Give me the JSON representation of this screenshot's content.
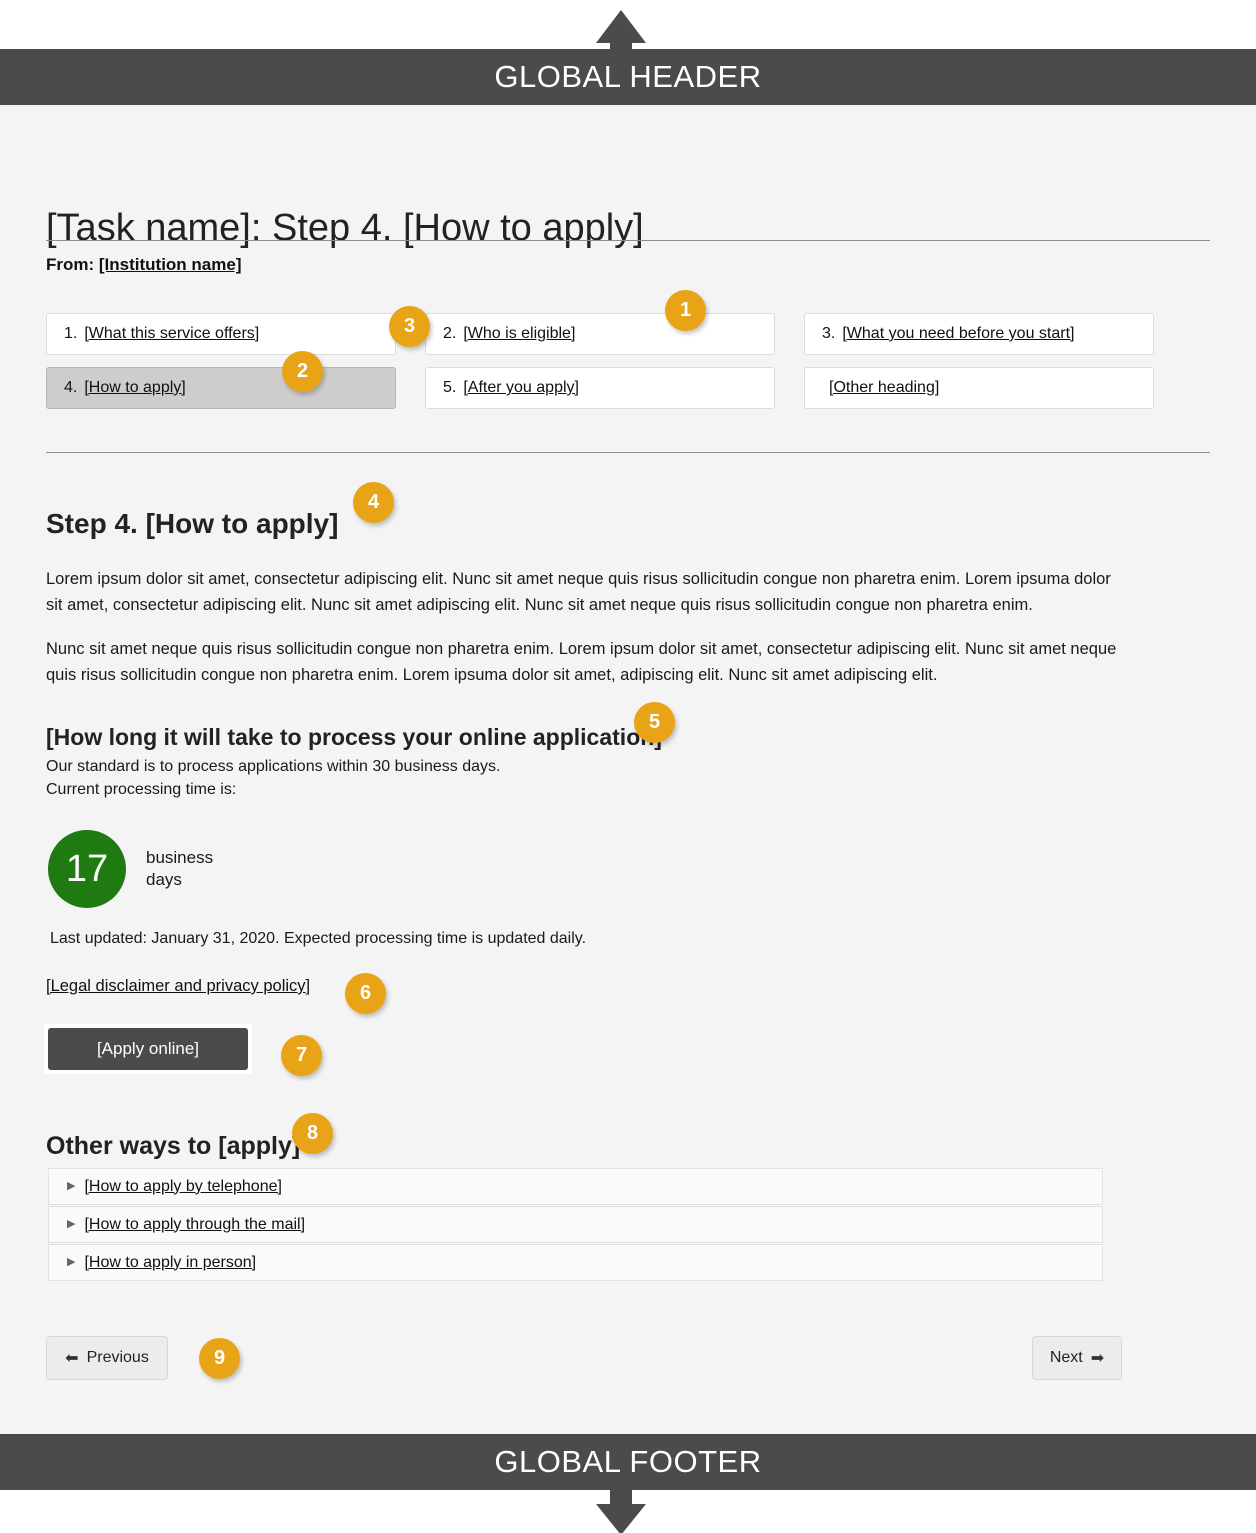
{
  "global": {
    "header_label": "GLOBAL HEADER",
    "footer_label": "GLOBAL FOOTER",
    "bar_color": "#4b4b4b",
    "canvas_color": "#f4f4f4"
  },
  "callouts": {
    "color": "#e8a317",
    "items": [
      "1",
      "2",
      "3",
      "4",
      "5",
      "6",
      "7",
      "8",
      "9"
    ]
  },
  "page": {
    "title": "[Task name]: Step 4. [How to apply]",
    "from_prefix": "From: ",
    "from_institution": "[Institution name]"
  },
  "nav_tiles": [
    {
      "num": "1.",
      "label": "[What this service offers]",
      "active": false
    },
    {
      "num": "2.",
      "label": "[Who is eligible]",
      "active": false
    },
    {
      "num": "3.",
      "label": "[What you need before you start]",
      "active": false
    },
    {
      "num": "4.",
      "label": "[How to apply]",
      "active": true
    },
    {
      "num": "5.",
      "label": "[After you apply]",
      "active": false
    },
    {
      "num": "",
      "label": "[Other heading]",
      "active": false
    }
  ],
  "step": {
    "heading": "Step 4.  [How to apply]",
    "paragraph_1": "Lorem ipsum dolor sit amet, consectetur adipiscing elit. Nunc sit amet neque quis  risus sollicitudin congue non pharetra enim. Lorem ipsuma dolor sit amet, consectetur adipiscing elit. Nunc sit amet adipiscing elit. Nunc sit amet neque quis risus sollicitudin congue non pharetra enim.",
    "paragraph_2": "Nunc sit amet neque quis risus sollicitudin congue non pharetra enim.  Lorem ipsum dolor sit amet, consectetur adipiscing elit. Nunc sit amet neque quis  risus sollicitudin congue non pharetra enim. Lorem ipsuma dolor sit amet, adipiscing elit. Nunc sit amet adipiscing elit."
  },
  "processing": {
    "heading": "[How long it will take to process your online application]",
    "standard_line": "Our standard is to process applications within 30 business days.",
    "current_line": "Current processing time is:",
    "days_value": "17",
    "days_unit_line_1": "business",
    "days_unit_line_2": "days",
    "circle_color": "#1f7a11",
    "last_updated": "Last updated: January 31, 2020. Expected processing time is updated daily."
  },
  "legal": {
    "link_text": "[Legal disclaimer and privacy policy",
    "link_tail": "]"
  },
  "apply": {
    "button_label": "[Apply online]"
  },
  "other_ways": {
    "heading": "Other ways to [apply]",
    "rows": [
      {
        "label": "[How to apply by telephone]",
        "icon": "triangle-right-icon"
      },
      {
        "label": "[How to apply through the mail]",
        "icon": "triangle-right-icon"
      },
      {
        "label": "[How to apply in person]",
        "icon": "triangle-right-icon"
      }
    ]
  },
  "pager": {
    "previous_label": "Previous",
    "previous_icon": "arrow-left-icon",
    "next_label": "Next",
    "next_icon": "arrow-right-icon"
  }
}
